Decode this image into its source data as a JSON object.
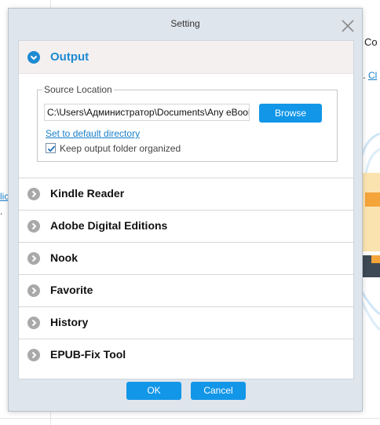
{
  "background": {
    "partial_heading": "Co",
    "partial_text_1": "t.",
    "partial_link_1": "Cl",
    "partial_link_2": "lic",
    "partial_text_2": "."
  },
  "dialog": {
    "title": "Setting",
    "output": {
      "label": "Output",
      "source_location_legend": "Source Location",
      "path_value": "C:\\Users\\Администратор\\Documents\\Any eBook",
      "browse_label": "Browse",
      "default_link": "Set to default directory",
      "keep_organized_label": "Keep output folder organized",
      "keep_organized_checked": true
    },
    "sections": [
      {
        "label": "Kindle Reader"
      },
      {
        "label": "Adobe Digital Editions"
      },
      {
        "label": "Nook"
      },
      {
        "label": "Favorite"
      },
      {
        "label": "History"
      },
      {
        "label": "EPUB-Fix Tool"
      }
    ],
    "ok_label": "OK",
    "cancel_label": "Cancel"
  },
  "colors": {
    "accent": "#1296e8",
    "output_label": "#1e8ad2",
    "dialog_frame": "#dfe5ec",
    "section_icon": "#a9a9a9"
  }
}
